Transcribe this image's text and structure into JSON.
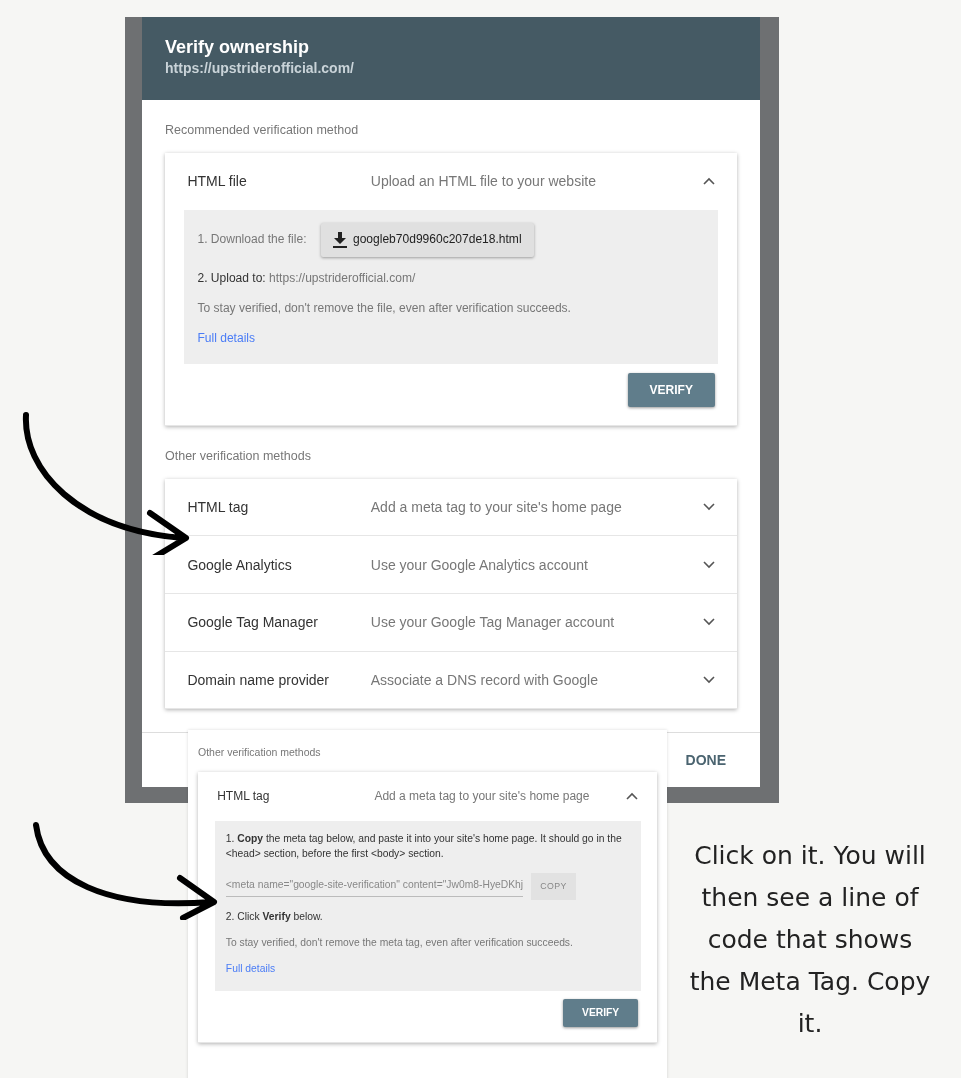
{
  "main_screenshot": {
    "dialog": {
      "title": "Verify ownership",
      "subtitle": "https://upstriderofficial.com/",
      "recommended_heading": "Recommended verification method",
      "recommended": [
        {
          "name": "HTML file",
          "description": "Upload an HTML file to your website",
          "expanded": true,
          "kind": "file",
          "download_label": "1. Download the file:",
          "file_button": "googleb70d9960c207de18.html",
          "upload_label": "2. Upload to:",
          "upload_url": "https://upstriderofficial.com/",
          "note": "To stay verified, don't remove the file, even after verification succeeds.",
          "link": "Full details",
          "verify_button": "VERIFY"
        }
      ],
      "other_heading": "Other verification methods",
      "other_methods": [
        {
          "name": "HTML tag",
          "description": "Add a meta tag to your site's home page",
          "expanded": false
        },
        {
          "name": "Google Analytics",
          "description": "Use your Google Analytics account",
          "expanded": false
        },
        {
          "name": "Google Tag Manager",
          "description": "Use your Google Tag Manager account",
          "expanded": false
        },
        {
          "name": "Domain name provider",
          "description": "Associate a DNS record with Google",
          "expanded": false
        }
      ],
      "done_button": "DONE"
    }
  },
  "inset_screenshot": {
    "other_heading": "Other verification methods",
    "methods": [
      {
        "name": "HTML tag",
        "description": "Add a meta tag to your site's home page",
        "expanded": true,
        "kind": "meta_tag",
        "instruction": "1. **Copy** the meta tag below, and paste it into your site's home page. It should go in the <head> section, before the first <body> section.",
        "code_field": "<meta name=\"google-site-verification\" content=\"Jw0m8-HyeDKhj",
        "copy_button": "COPY",
        "step_2": "2. Click **Verify** below.",
        "note": "To stay verified, don't remove the meta tag, even after verification succeeds.",
        "link": "Full details",
        "verify_button": "VERIFY"
      }
    ]
  },
  "caption": "Click on it. You will then see a line of code that shows the Meta Tag. Copy it."
}
